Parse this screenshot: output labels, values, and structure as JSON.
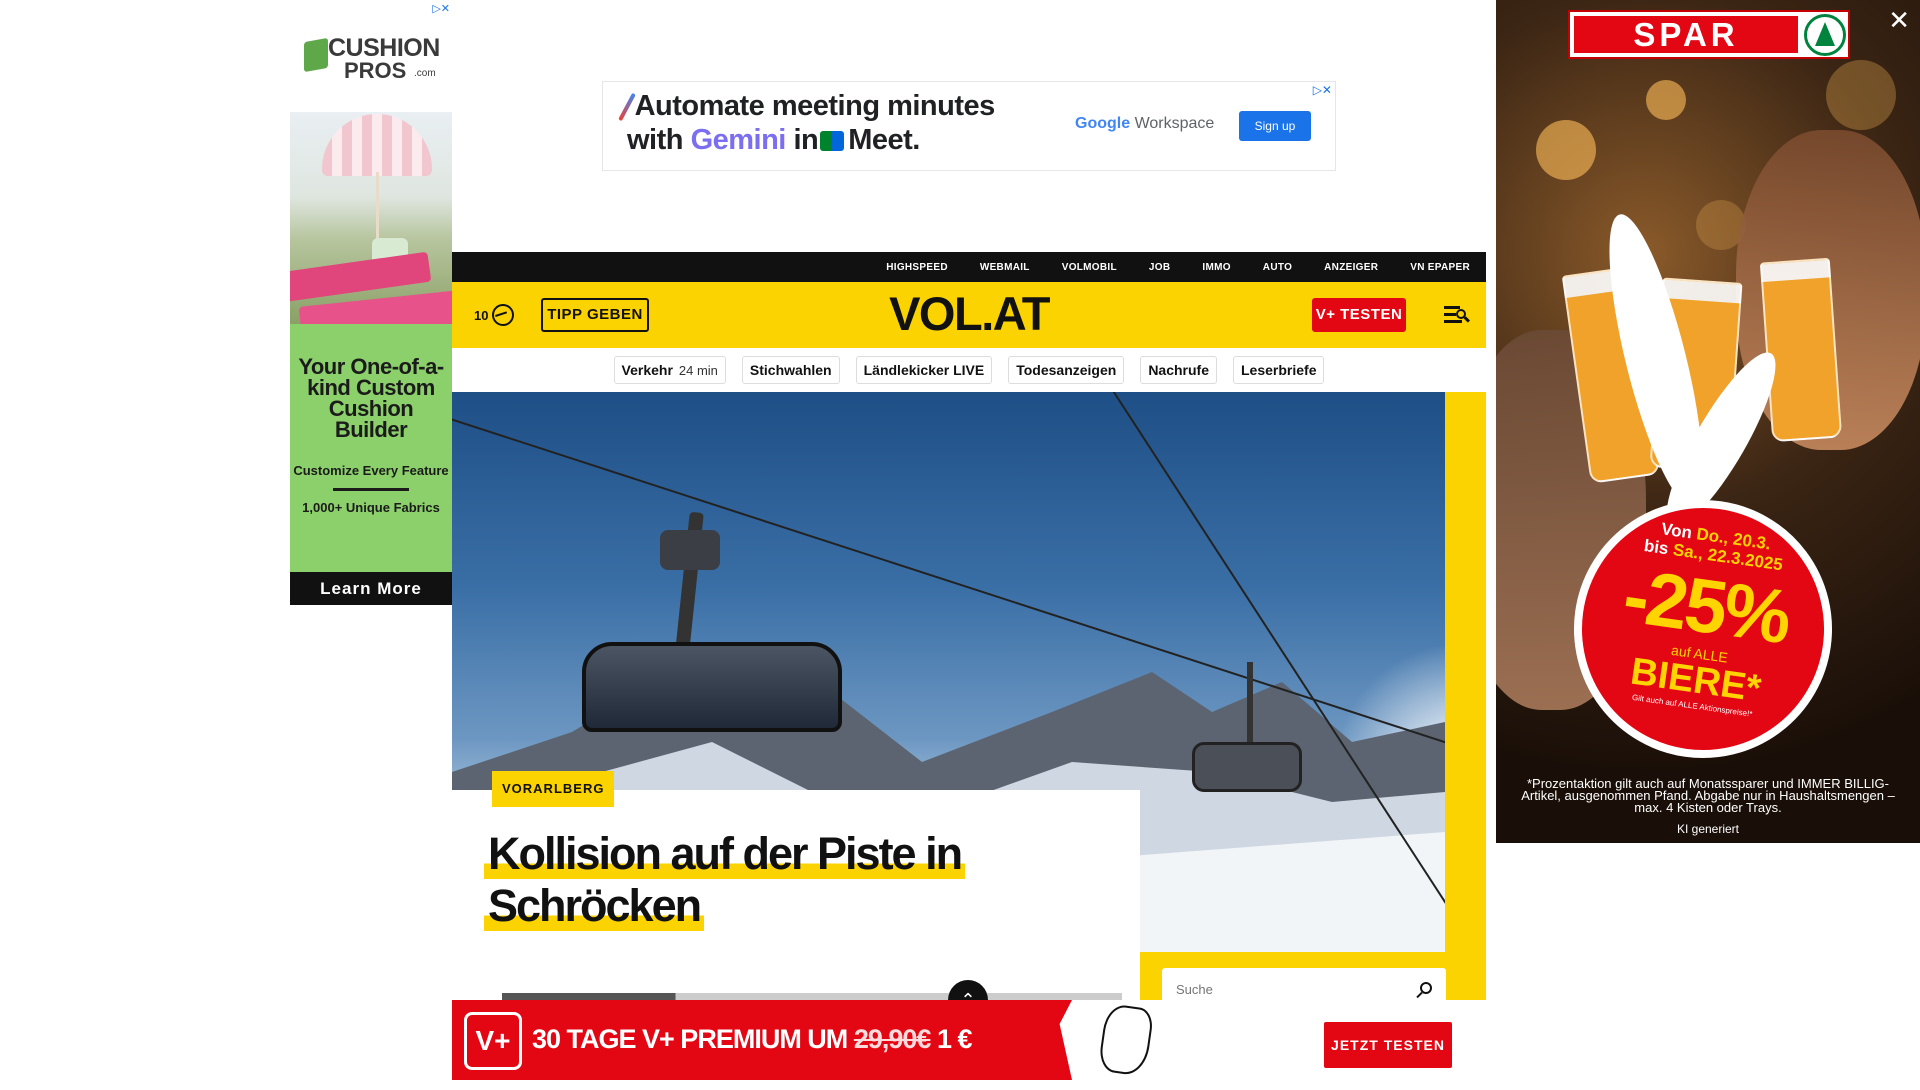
{
  "left_ad": {
    "brand_line1": "CUSHION",
    "brand_line2": "PROS",
    "brand_suffix": ".com",
    "headline": "Your One-of-a-kind Custom Cushion Builder",
    "sub1": "Customize Every Feature",
    "sub2": "1,000+ Unique Fabrics",
    "cta": "Learn More",
    "adchoice": "▷✕"
  },
  "top_ad": {
    "line1": "Automate meeting minutes",
    "line2_pre": "with",
    "line2_gemini": "Gemini",
    "line2_in": "in",
    "line2_meet": "Meet.",
    "google": "Google",
    "workspace": "Workspace",
    "signup": "Sign up",
    "adchoice": "▷✕"
  },
  "topnav": [
    "HIGHSPEED",
    "WEBMAIL",
    "VOLMOBIL",
    "JOB",
    "IMMO",
    "AUTO",
    "ANZEIGER",
    "VN EPAPER"
  ],
  "header": {
    "temperature": "10",
    "tipp": "TIPP GEBEN",
    "logo": "VOL.AT",
    "vplus": "V+ TESTEN"
  },
  "quicklinks": [
    {
      "label": "Verkehr",
      "sub": "24 min"
    },
    {
      "label": "Stichwahlen",
      "sub": ""
    },
    {
      "label": "Ländlekicker LIVE",
      "sub": ""
    },
    {
      "label": "Todesanzeigen",
      "sub": ""
    },
    {
      "label": "Nachrufe",
      "sub": ""
    },
    {
      "label": "Leserbriefe",
      "sub": ""
    }
  ],
  "story": {
    "tag": "VORARLBERG",
    "headline_line1": "Kollision auf der Piste in",
    "headline_line2": "Schröcken"
  },
  "search": {
    "placeholder": "Suche"
  },
  "promo": {
    "badge": "V+",
    "text_pre": "30 TAGE V+ PREMIUM UM",
    "old_price": "29,90€",
    "new_price": "1 €",
    "cta": "JETZT TESTEN"
  },
  "right_ad": {
    "brand": "SPAR",
    "close": "✕",
    "date_line1_pre": "Von",
    "date_line1_val": "Do., 20.3.",
    "date_line2_pre": "bis",
    "date_line2_val": "Sa., 22.3.2025",
    "percent": "-25%",
    "auf": "auf ALLE",
    "biere": "BIERE*",
    "gilt": "Gilt auch auf ALLE Aktionspreise!*",
    "fine": "*Prozentaktion gilt auch auf Monatssparer und IMMER BILLIG-Artikel, ausgenommen Pfand. Abgabe nur in Haushaltsmengen – max. 4 Kisten oder Trays.",
    "ki": "KI generiert"
  }
}
